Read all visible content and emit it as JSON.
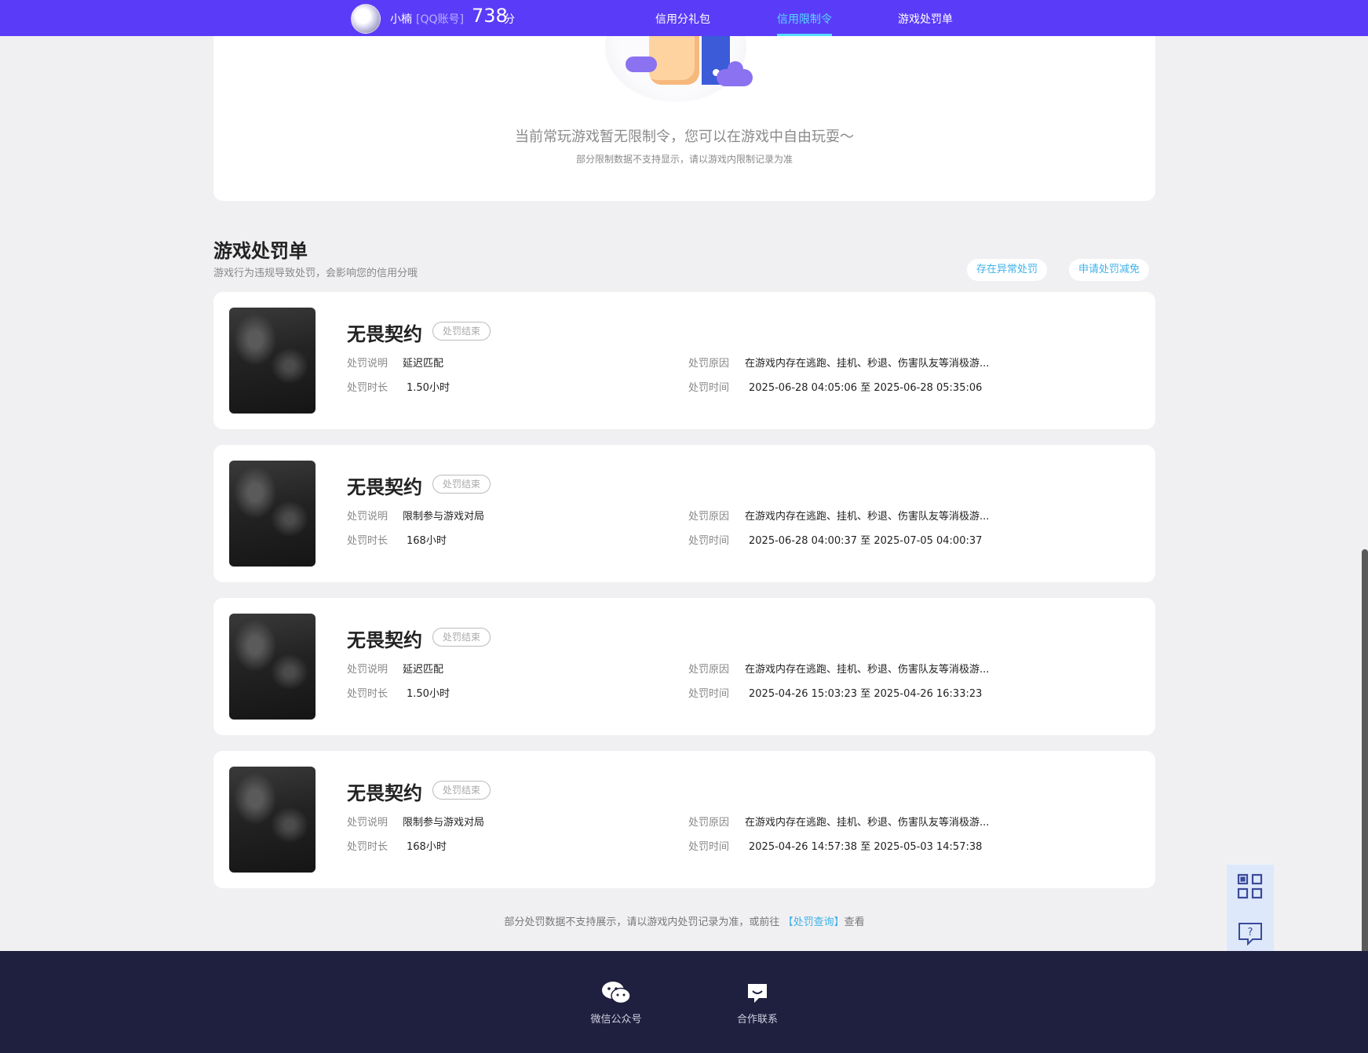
{
  "header": {
    "username": "小楠",
    "account_type": "[QQ账号]",
    "score": "738",
    "score_unit": "分",
    "nav": [
      "信用分礼包",
      "信用限制令",
      "游戏处罚单"
    ],
    "active_nav": "信用限制令",
    "accent_color": "#5a3cf8",
    "active_color": "#56d9ff"
  },
  "restriction": {
    "message": "当前常玩游戏暂无限制令，您可以在游戏中自由玩耍～",
    "note": "部分限制数据不支持显示，请以游戏内限制记录为准"
  },
  "penalty_section": {
    "title": "游戏处罚单",
    "subtitle": "游戏行为违规导致处罚，会影响您的信用分哦",
    "btn_abnormal": "存在异常处罚",
    "btn_appeal": "申请处罚减免"
  },
  "labels": {
    "desc": "处罚说明",
    "duration": "处罚时长",
    "reason": "处罚原因",
    "time": "处罚时间"
  },
  "penalties": [
    {
      "game": "无畏契约",
      "status": "处罚结束",
      "desc": "延迟匹配",
      "duration": "1.50小时",
      "reason": "在游戏内存在逃跑、挂机、秒退、伤害队友等消极游...",
      "time": "2025-06-28 04:05:06 至 2025-06-28 05:35:06"
    },
    {
      "game": "无畏契约",
      "status": "处罚结束",
      "desc": "限制参与游戏对局",
      "duration": "168小时",
      "reason": "在游戏内存在逃跑、挂机、秒退、伤害队友等消极游...",
      "time": "2025-06-28 04:00:37 至 2025-07-05 04:00:37"
    },
    {
      "game": "无畏契约",
      "status": "处罚结束",
      "desc": "延迟匹配",
      "duration": "1.50小时",
      "reason": "在游戏内存在逃跑、挂机、秒退、伤害队友等消极游...",
      "time": "2025-04-26 15:03:23 至 2025-04-26 16:33:23"
    },
    {
      "game": "无畏契约",
      "status": "处罚结束",
      "desc": "限制参与游戏对局",
      "duration": "168小时",
      "reason": "在游戏内存在逃跑、挂机、秒退、伤害队友等消极游...",
      "time": "2025-04-26 14:57:38 至 2025-05-03 14:57:38"
    }
  ],
  "footer_note": {
    "before": "部分处罚数据不支持展示，请以游戏内处罚记录为准，或前往",
    "link": "【处罚查询】",
    "after": "查看"
  },
  "footer": {
    "wechat": "微信公众号",
    "contact": "合作联系"
  },
  "icons": [
    "avatar",
    "qr-code-icon",
    "help-chat-icon",
    "wechat-icon",
    "message-icon"
  ]
}
